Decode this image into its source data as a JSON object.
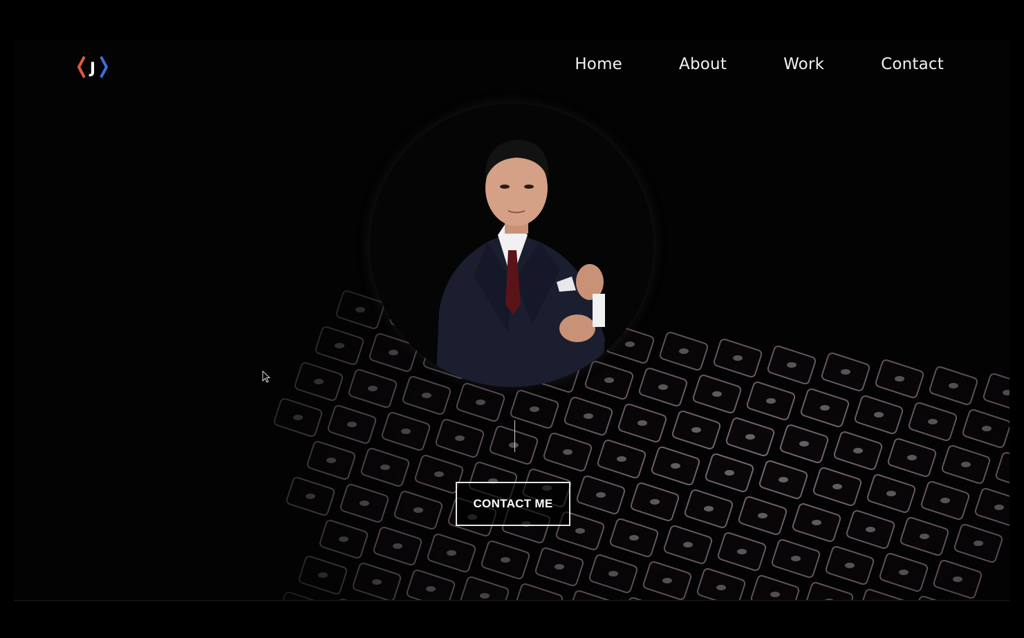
{
  "logo": {
    "letter": "J",
    "left_color": "#e05a3a",
    "right_color": "#3b6fd8"
  },
  "nav": {
    "items": [
      {
        "label": "Home"
      },
      {
        "label": "About"
      },
      {
        "label": "Work"
      },
      {
        "label": "Contact"
      }
    ]
  },
  "hero": {
    "portrait_icon": "person-portrait",
    "cta_label": "CONTACT ME"
  },
  "colors": {
    "background": "#000000",
    "text": "#f2f2f2"
  }
}
